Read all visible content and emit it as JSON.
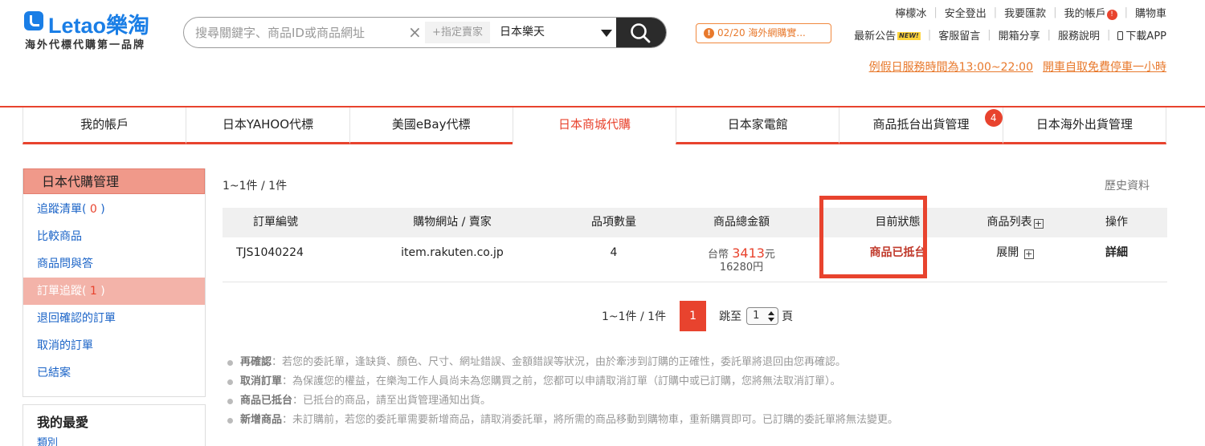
{
  "logo": {
    "brand": "Letao樂淘",
    "tagline": "海外代標代購第一品牌"
  },
  "search": {
    "placeholder": "搜尋關鍵字、商品ID或商品網址",
    "clear": "×",
    "seller_button": "+指定賣家",
    "site_selected": "日本樂天"
  },
  "topnav": {
    "items": [
      "檸檬冰",
      "安全登出",
      "我要匯款",
      "我的帳戶",
      "購物車"
    ],
    "account_badge": "!"
  },
  "notice": {
    "text": "02/20 海外網購實...",
    "icon": "!"
  },
  "subnav": {
    "news": "最新公告",
    "news_badge": "NEW!",
    "items": [
      "客服留言",
      "開箱分享",
      "服務說明",
      "下載APP"
    ]
  },
  "hours": {
    "service": "例假日服務時間為13:00~22:00",
    "parking": "開車自取免費停車一小時"
  },
  "tabs": [
    {
      "label": "我的帳戶"
    },
    {
      "label": "日本YAHOO代標"
    },
    {
      "label": "美國eBay代標"
    },
    {
      "label": "日本商城代購"
    },
    {
      "label": "日本家電館"
    },
    {
      "label": "商品抵台出貨管理",
      "badge": "4"
    },
    {
      "label": "日本海外出貨管理"
    }
  ],
  "sidebar": {
    "title": "日本代購管理",
    "items": [
      {
        "label": "追蹤清單(",
        "count": " 0 ",
        "suffix": ")"
      },
      {
        "label": "比較商品"
      },
      {
        "label": "商品問與答"
      },
      {
        "label": "訂單追蹤(",
        "count": " 1 ",
        "suffix": ")"
      },
      {
        "label": "退回確認的訂單"
      },
      {
        "label": "取消的訂單"
      },
      {
        "label": "已結案"
      }
    ],
    "favorites_title": "我的最愛",
    "favorites_sub": "類別"
  },
  "content": {
    "count_top": "1~1件 / 1件",
    "history": "歷史資料",
    "table": {
      "headers": [
        "訂單編號",
        "購物網站 / 賣家",
        "品項數量",
        "商品總金額",
        "目前狀態",
        "商品列表",
        "操作"
      ],
      "rows": [
        {
          "order_id": "TJS1040224",
          "site": "item.rakuten.co.jp",
          "qty": "4",
          "price_prefix": "台幣",
          "price_twd": "3413",
          "price_unit": "元",
          "price_jpy": "16280円",
          "status": "商品已抵台",
          "expand": "展開",
          "action": "詳細"
        }
      ]
    },
    "pager": {
      "count": "1~1件 / 1件",
      "current": "1",
      "jump_label": "跳至",
      "jump_value": "1",
      "page_unit": "頁"
    },
    "notes": [
      {
        "title": "再確認",
        "text": "：若您的委託單，逢缺貨、顏色、尺寸、網址錯誤、金額錯誤等狀況，由於牽涉到訂購的正確性，委託單將退回由您再確認。"
      },
      {
        "title": "取消訂單",
        "text": "：為保護您的權益，在樂淘工作人員尚未為您購買之前，您都可以申請取消訂單（訂購中或已訂購，您將無法取消訂單）。"
      },
      {
        "title": "商品已抵台",
        "text": "：已抵台的商品，請至出貨管理通知出貨。"
      },
      {
        "title": "新增商品",
        "text": "：未訂購前，若您的委託單需要新增商品，請取消委託單，將所需的商品移動到購物車，重新購買即可。已訂購的委託單將無法變更。"
      }
    ]
  },
  "colors": {
    "accent": "#e8432e",
    "link": "#1a63c7",
    "orange": "#e8792c",
    "brand": "#1a7ee6"
  }
}
